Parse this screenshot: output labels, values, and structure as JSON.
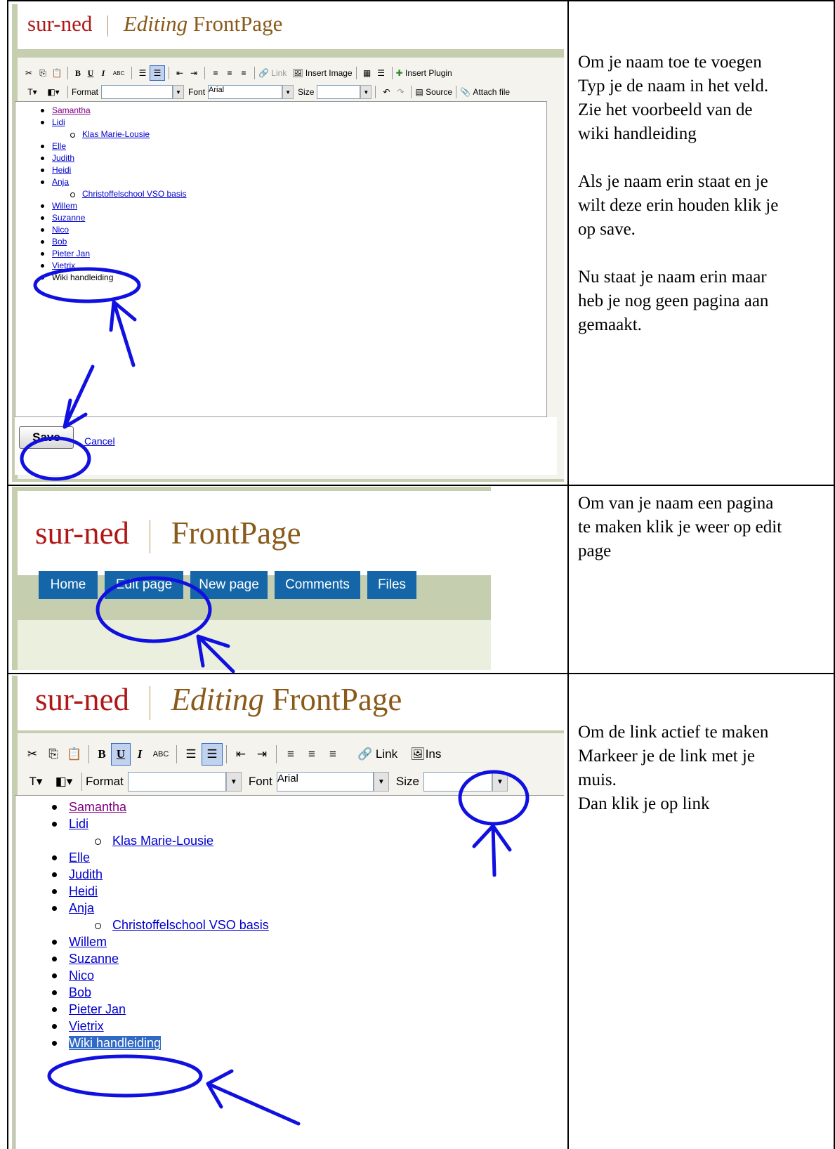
{
  "panel1": {
    "site_name": "sur-ned",
    "editing_word": "Editing",
    "page_name": "FrontPage",
    "toolbar": {
      "bold": "B",
      "underline": "U",
      "italic": "I",
      "spell": "ABC",
      "link": "Link",
      "insert_image": "Insert Image",
      "insert_plugin": "Insert Plugin",
      "format_label": "Format",
      "font_label": "Font",
      "font_value": "Arial",
      "size_label": "Size",
      "source": "Source",
      "attach_file": "Attach file"
    },
    "list": [
      "Samantha",
      "Lidi",
      "Klas Marie-Lousie",
      "Elle",
      "Judith",
      "Heidi",
      "Anja",
      "Christoffelschool VSO basis",
      "Willem",
      "Suzanne",
      "Nico",
      "Bob",
      "Pieter Jan",
      "Vietrix",
      "Wiki handleiding"
    ],
    "save": "Save",
    "cancel": "Cancel"
  },
  "panel2": {
    "site_name": "sur-ned",
    "page_name": "FrontPage",
    "tabs": [
      "Home",
      "Edit page",
      "New page",
      "Comments",
      "Files"
    ]
  },
  "panel3": {
    "site_name": "sur-ned",
    "editing_word": "Editing",
    "page_name": "FrontPage",
    "toolbar": {
      "bold": "B",
      "underline": "U",
      "italic": "I",
      "spell": "ABC",
      "link": "Link",
      "ins": "Ins",
      "format_label": "Format",
      "font_label": "Font",
      "font_value": "Arial",
      "size_label": "Size"
    },
    "list": [
      "Samantha",
      "Lidi",
      "Klas Marie-Lousie",
      "Elle",
      "Judith",
      "Heidi",
      "Anja",
      "Christoffelschool VSO basis",
      "Willem",
      "Suzanne",
      "Nico",
      "Bob",
      "Pieter Jan",
      "Vietrix",
      "Wiki handleiding"
    ]
  },
  "instructions": {
    "step1": {
      "p1": [
        "Om je naam toe te voegen",
        "Typ je de naam in het veld.",
        "Zie het voorbeeld van de",
        "wiki handleiding"
      ],
      "p2": [
        "Als je naam erin staat en je",
        "wilt deze erin houden klik je",
        "op save."
      ],
      "p3": [
        "Nu staat je naam erin maar",
        "heb je nog geen pagina aan",
        "gemaakt."
      ]
    },
    "step2": {
      "p1": [
        "Om van je naam een pagina",
        "te maken klik je weer op edit",
        "page"
      ]
    },
    "step3": {
      "p1": [
        "Om de link actief te maken",
        "Markeer je de link met je",
        "muis.",
        "Dan klik je op link"
      ]
    }
  },
  "colors": {
    "annotation": "#1010e0",
    "site_red": "#b01818",
    "page_brown": "#8a5a1a",
    "tab_blue": "#1466a8",
    "frame_green": "#c6ceb0"
  }
}
